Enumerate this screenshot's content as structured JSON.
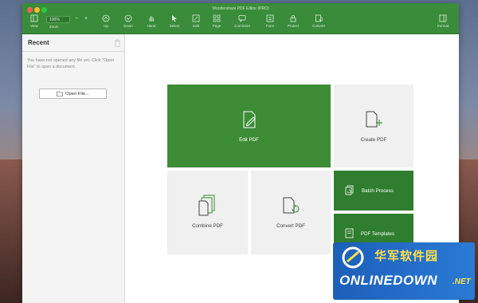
{
  "window": {
    "title": "Wondershare PDF Editor (PRO)"
  },
  "toolbar": {
    "zoom_value": "100%",
    "zoom_label": "Zoom",
    "zoom_minus": "−",
    "zoom_plus": "+",
    "items": [
      {
        "label": "View",
        "icon": "view-icon"
      },
      {
        "label": "Up",
        "icon": "up-icon"
      },
      {
        "label": "Down",
        "icon": "down-icon"
      },
      {
        "label": "Hand",
        "icon": "hand-icon"
      },
      {
        "label": "Select",
        "icon": "select-icon"
      },
      {
        "label": "Edit",
        "icon": "edit-icon"
      },
      {
        "label": "Page",
        "icon": "page-icon"
      },
      {
        "label": "Comment",
        "icon": "comment-icon"
      },
      {
        "label": "Form",
        "icon": "form-icon"
      },
      {
        "label": "Protect",
        "icon": "protect-icon"
      },
      {
        "label": "Convert",
        "icon": "convert-icon"
      },
      {
        "label": "Format",
        "icon": "format-icon"
      }
    ]
  },
  "sidebar": {
    "title": "Recent",
    "empty_message": "You have not opened any file yet. Click \"Open File\" to open a document.",
    "open_file_label": "Open File..."
  },
  "tiles": {
    "edit": "Edit PDF",
    "create": "Create PDF",
    "combine": "Combine PDF",
    "convert": "Convert PDF",
    "batch": "Batch Process",
    "templates": "PDF Templates"
  },
  "watermark": {
    "cn": "华军软件园",
    "en": "ONLINEDOWN",
    "suffix": ".NET"
  },
  "colors": {
    "toolbar": "#3a8c3a",
    "accent_green": "#3d8c36",
    "dark_green": "#2f7d2f",
    "tile_gray": "#f0f0f0"
  }
}
